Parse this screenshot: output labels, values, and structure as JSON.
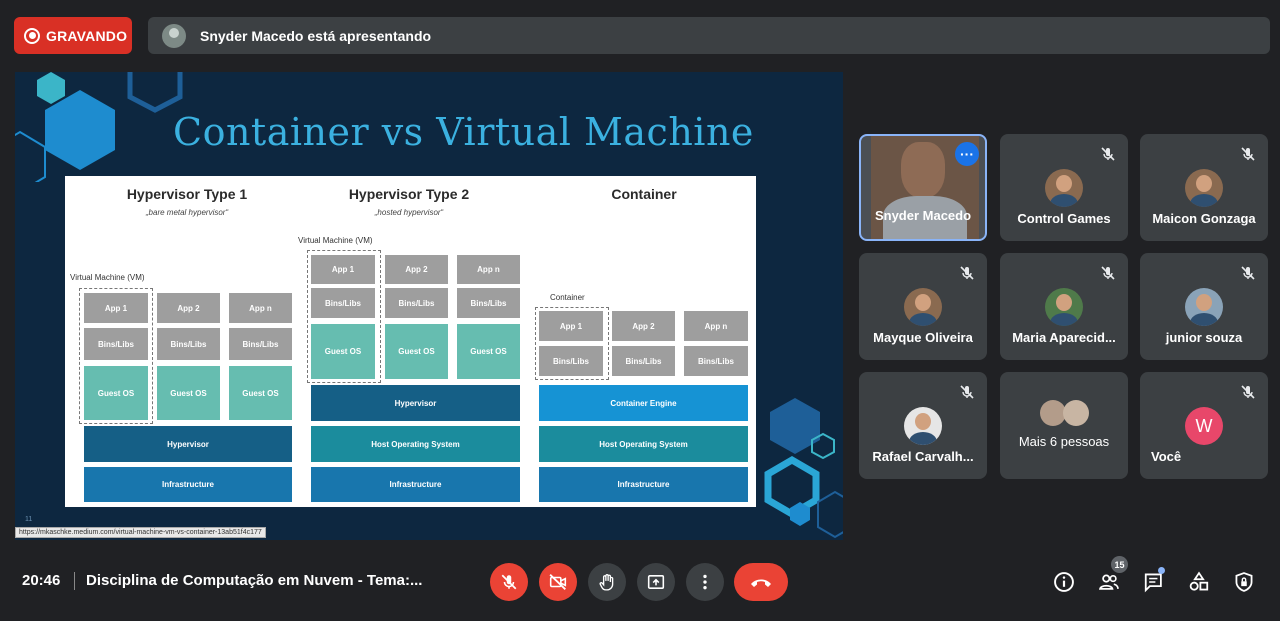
{
  "top": {
    "recording_label": "GRAVANDO",
    "presenter_text": "Snyder Macedo está apresentando"
  },
  "slide": {
    "title": "Container vs Virtual Machine",
    "source_url": "https://mkaschke.medium.com/virtual-machine-vm-vs-container-13ab51f4c177",
    "page_number": "11",
    "hypervisor1": {
      "heading": "Hypervisor Type 1",
      "subtitle": "„bare metal hypervisor“",
      "vm_label": "Virtual Machine (VM)",
      "apps": [
        "App 1",
        "App 2",
        "App n"
      ],
      "bins": [
        "Bins/Libs",
        "Bins/Libs",
        "Bins/Libs"
      ],
      "guest": [
        "Guest OS",
        "Guest OS",
        "Guest OS"
      ],
      "hypervisor": "Hypervisor",
      "infrastructure": "Infrastructure"
    },
    "hypervisor2": {
      "heading": "Hypervisor Type 2",
      "subtitle": "„hosted hypervisor“",
      "vm_label": "Virtual Machine (VM)",
      "apps": [
        "App 1",
        "App 2",
        "App n"
      ],
      "bins": [
        "Bins/Libs",
        "Bins/Libs",
        "Bins/Libs"
      ],
      "guest": [
        "Guest OS",
        "Guest OS",
        "Guest OS"
      ],
      "hypervisor": "Hypervisor",
      "host_os": "Host Operating System",
      "infrastructure": "Infrastructure"
    },
    "container": {
      "heading": "Container",
      "container_label": "Container",
      "apps": [
        "App 1",
        "App 2",
        "App n"
      ],
      "bins": [
        "Bins/Libs",
        "Bins/Libs",
        "Bins/Libs"
      ],
      "engine": "Container Engine",
      "host_os": "Host Operating System",
      "infrastructure": "Infrastructure"
    }
  },
  "participants": [
    {
      "name": "Snyder Macedo",
      "active": true
    },
    {
      "name": "Control Games"
    },
    {
      "name": "Maicon Gonzaga"
    },
    {
      "name": "Mayque Oliveira"
    },
    {
      "name": "Maria Aparecid..."
    },
    {
      "name": "junior souza"
    },
    {
      "name": "Rafael Carvalh..."
    },
    {
      "name": "Mais 6 pessoas"
    },
    {
      "name": "Você",
      "initial": "W"
    }
  ],
  "bottom": {
    "time": "20:46",
    "meeting_title": "Disciplina de Computação em Nuvem - Tema:...",
    "participant_count": "15"
  },
  "colors": {
    "recording_red": "#d93025",
    "control_red": "#ea4335",
    "active_blue": "#8ab4f8",
    "slide_title_blue": "#3bb1e0"
  }
}
